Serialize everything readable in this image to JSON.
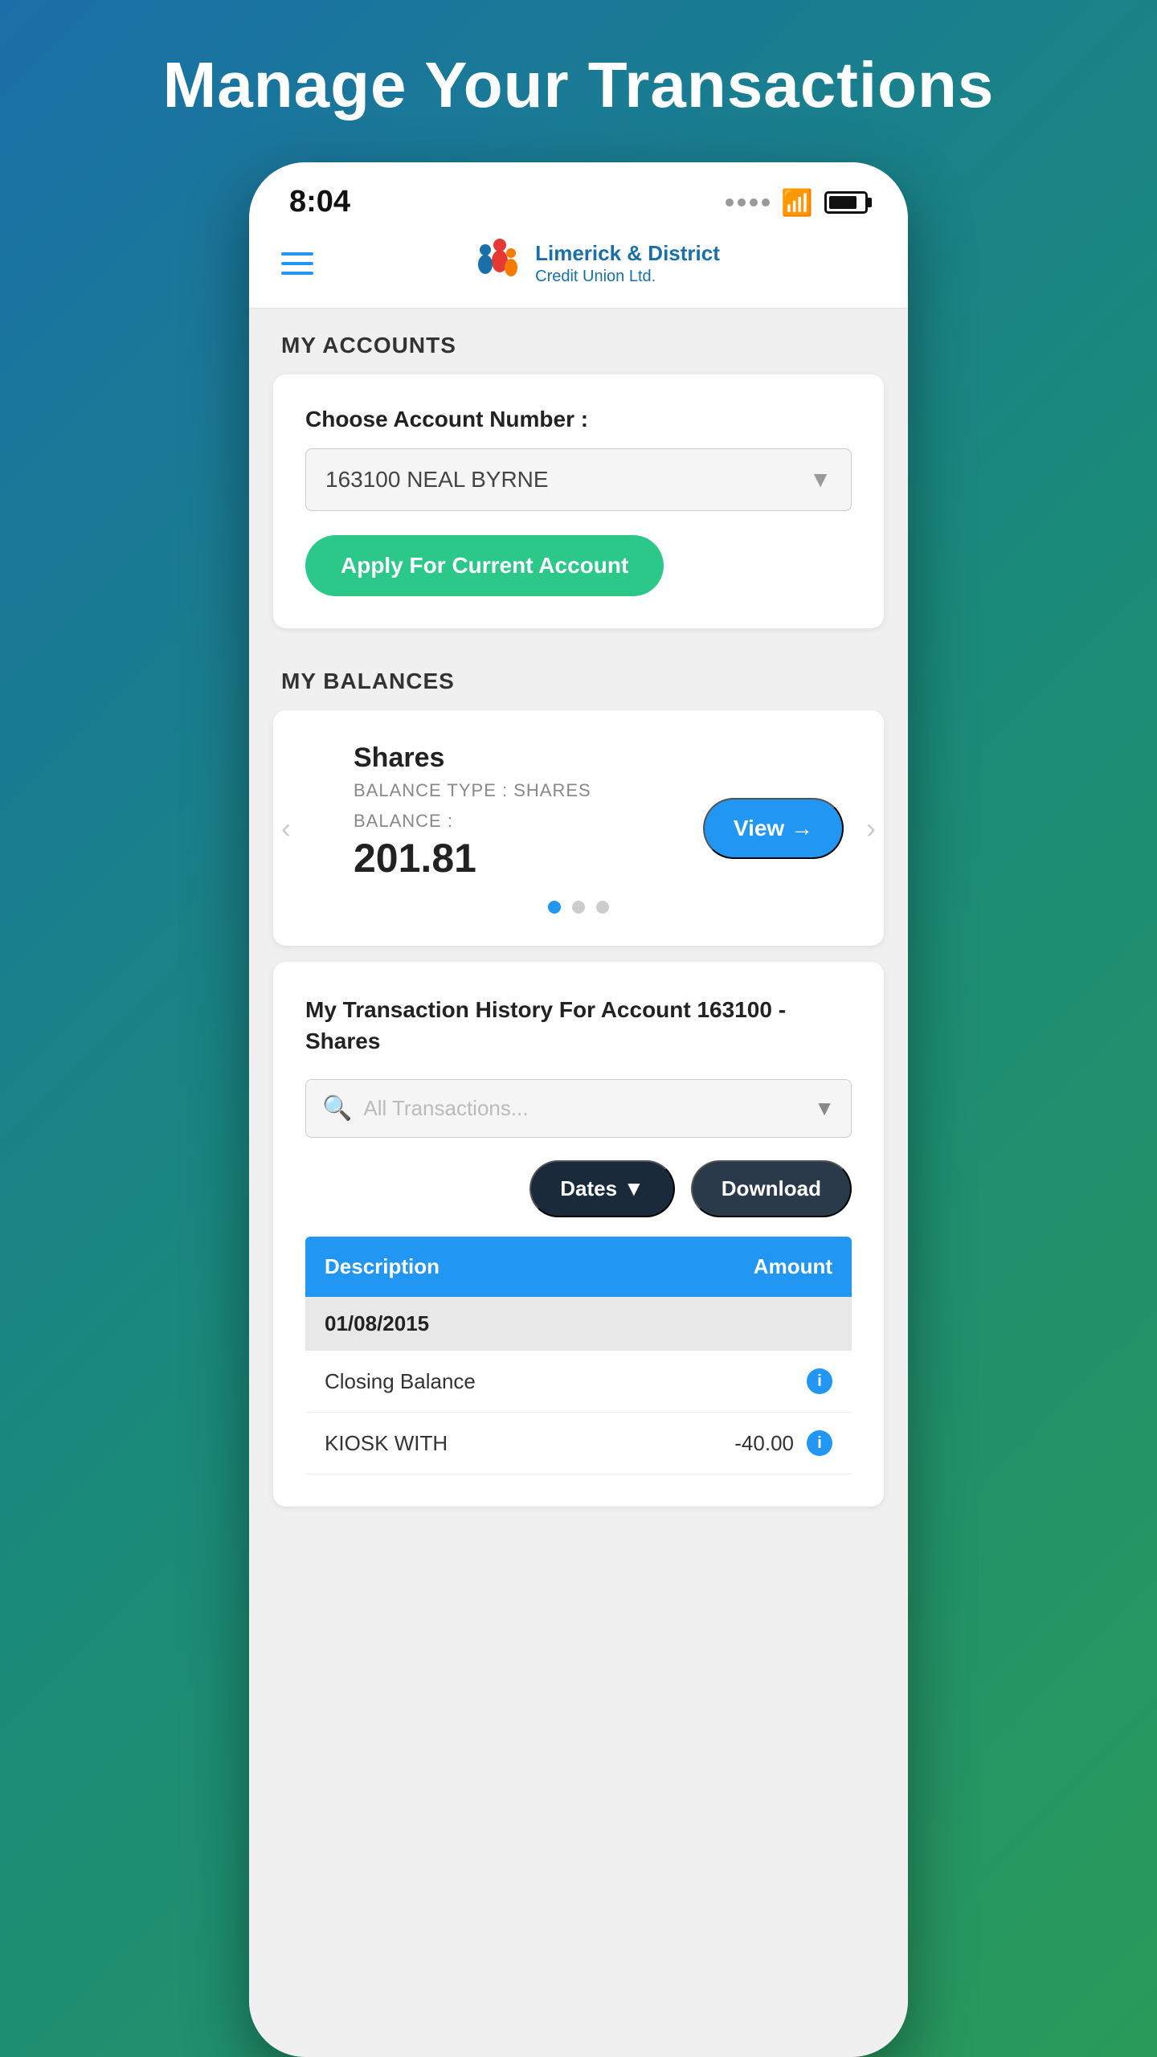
{
  "page": {
    "title": "Manage Your Transactions",
    "background_gradient": "linear-gradient(135deg, #1a6fa8, #1a8a7a, #2a9a5a)"
  },
  "status_bar": {
    "time": "8:04",
    "signal_label": "signal",
    "wifi_label": "wifi",
    "battery_label": "battery"
  },
  "nav": {
    "menu_label": "menu",
    "logo_name": "Limerick & District",
    "logo_sub": "Credit Union Ltd."
  },
  "my_accounts": {
    "section_label": "MY ACCOUNTS",
    "choose_label": "Choose Account Number :",
    "account_value": "163100 NEAL BYRNE",
    "account_placeholder": "163100 NEAL BYRNE",
    "apply_button_label": "Apply For Current Account"
  },
  "my_balances": {
    "section_label": "MY BALANCES",
    "balance_title": "Shares",
    "balance_type_label": "BALANCE TYPE : SHARES",
    "balance_label": "BALANCE :",
    "balance_amount": "201.81",
    "view_button_label": "View →",
    "carousel_dots": [
      {
        "active": true
      },
      {
        "active": false
      },
      {
        "active": false
      }
    ]
  },
  "transactions": {
    "title": "My Transaction History For Account 163100 - Shares",
    "search_placeholder": "All Transactions...",
    "dates_button": "Dates",
    "download_button": "Download",
    "table_headers": {
      "description": "Description",
      "amount": "Amount"
    },
    "date_group": "01/08/2015",
    "rows": [
      {
        "description": "Closing Balance",
        "amount": "",
        "has_info": true
      },
      {
        "description": "KIOSK WITH",
        "amount": "-40.00",
        "has_info": true
      }
    ]
  }
}
